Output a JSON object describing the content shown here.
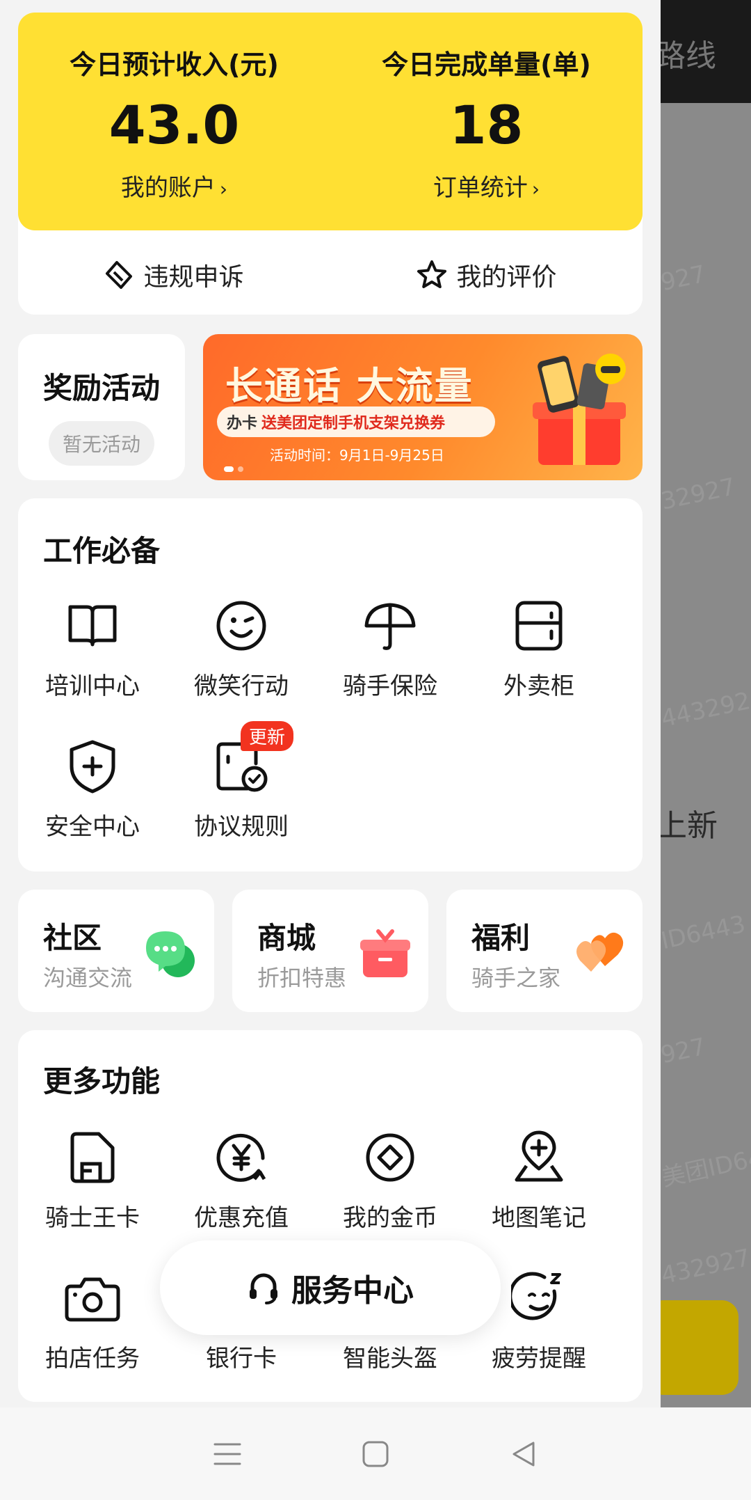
{
  "background_page": {
    "top_text": "路线",
    "mid_text": "上新",
    "watermarks": [
      "927",
      "32927",
      "443292",
      "ID6443",
      "927",
      "美团ID64",
      "432927"
    ]
  },
  "earnings": {
    "income_label": "今日预计收入(元)",
    "income_value": "43.0",
    "account_link": "我的账户",
    "orders_label": "今日完成单量(单)",
    "orders_value": "18",
    "stats_link": "订单统计",
    "arrow": "›"
  },
  "quick_actions": {
    "appeal": "违规申诉",
    "rating": "我的评价"
  },
  "rewards": {
    "title": "奖励活动",
    "status": "暂无活动"
  },
  "banner": {
    "title": "长通话 大流量",
    "tag": "办卡",
    "subtitle": "送美团定制手机支架兑换券",
    "date": "活动时间：9月1日-9月25日"
  },
  "work_essentials": {
    "title": "工作必备",
    "items": [
      {
        "label": "培训中心",
        "icon": "book-icon"
      },
      {
        "label": "微笑行动",
        "icon": "smile-icon"
      },
      {
        "label": "骑手保险",
        "icon": "umbrella-icon"
      },
      {
        "label": "外卖柜",
        "icon": "locker-icon"
      },
      {
        "label": "安全中心",
        "icon": "shield-plus-icon"
      },
      {
        "label": "协议规则",
        "icon": "document-check-icon",
        "badge": "更新"
      }
    ]
  },
  "community": [
    {
      "title": "社区",
      "subtitle": "沟通交流",
      "icon": "chat-bubbles-icon"
    },
    {
      "title": "商城",
      "subtitle": "折扣特惠",
      "icon": "gift-box-icon"
    },
    {
      "title": "福利",
      "subtitle": "骑手之家",
      "icon": "hearts-icon"
    }
  ],
  "more_features": {
    "title": "更多功能",
    "items": [
      {
        "label": "骑士王卡",
        "icon": "sim-card-icon"
      },
      {
        "label": "优惠充值",
        "icon": "yuan-coin-icon"
      },
      {
        "label": "我的金币",
        "icon": "coin-icon"
      },
      {
        "label": "地图笔记",
        "icon": "map-pin-plus-icon"
      },
      {
        "label": "拍店任务",
        "icon": "camera-icon"
      },
      {
        "label": "银行卡",
        "icon": "bank-card-icon"
      },
      {
        "label": "智能头盔",
        "icon": "helmet-icon"
      },
      {
        "label": "疲劳提醒",
        "icon": "sleepy-face-icon"
      }
    ]
  },
  "service_center": {
    "label": "服务中心"
  },
  "colors": {
    "accent_yellow": "#ffe033",
    "badge_red": "#f2331f",
    "chat_green": "#3fcf72",
    "gift_red": "#ff5b61",
    "heart_orange": "#ff8a3d"
  }
}
